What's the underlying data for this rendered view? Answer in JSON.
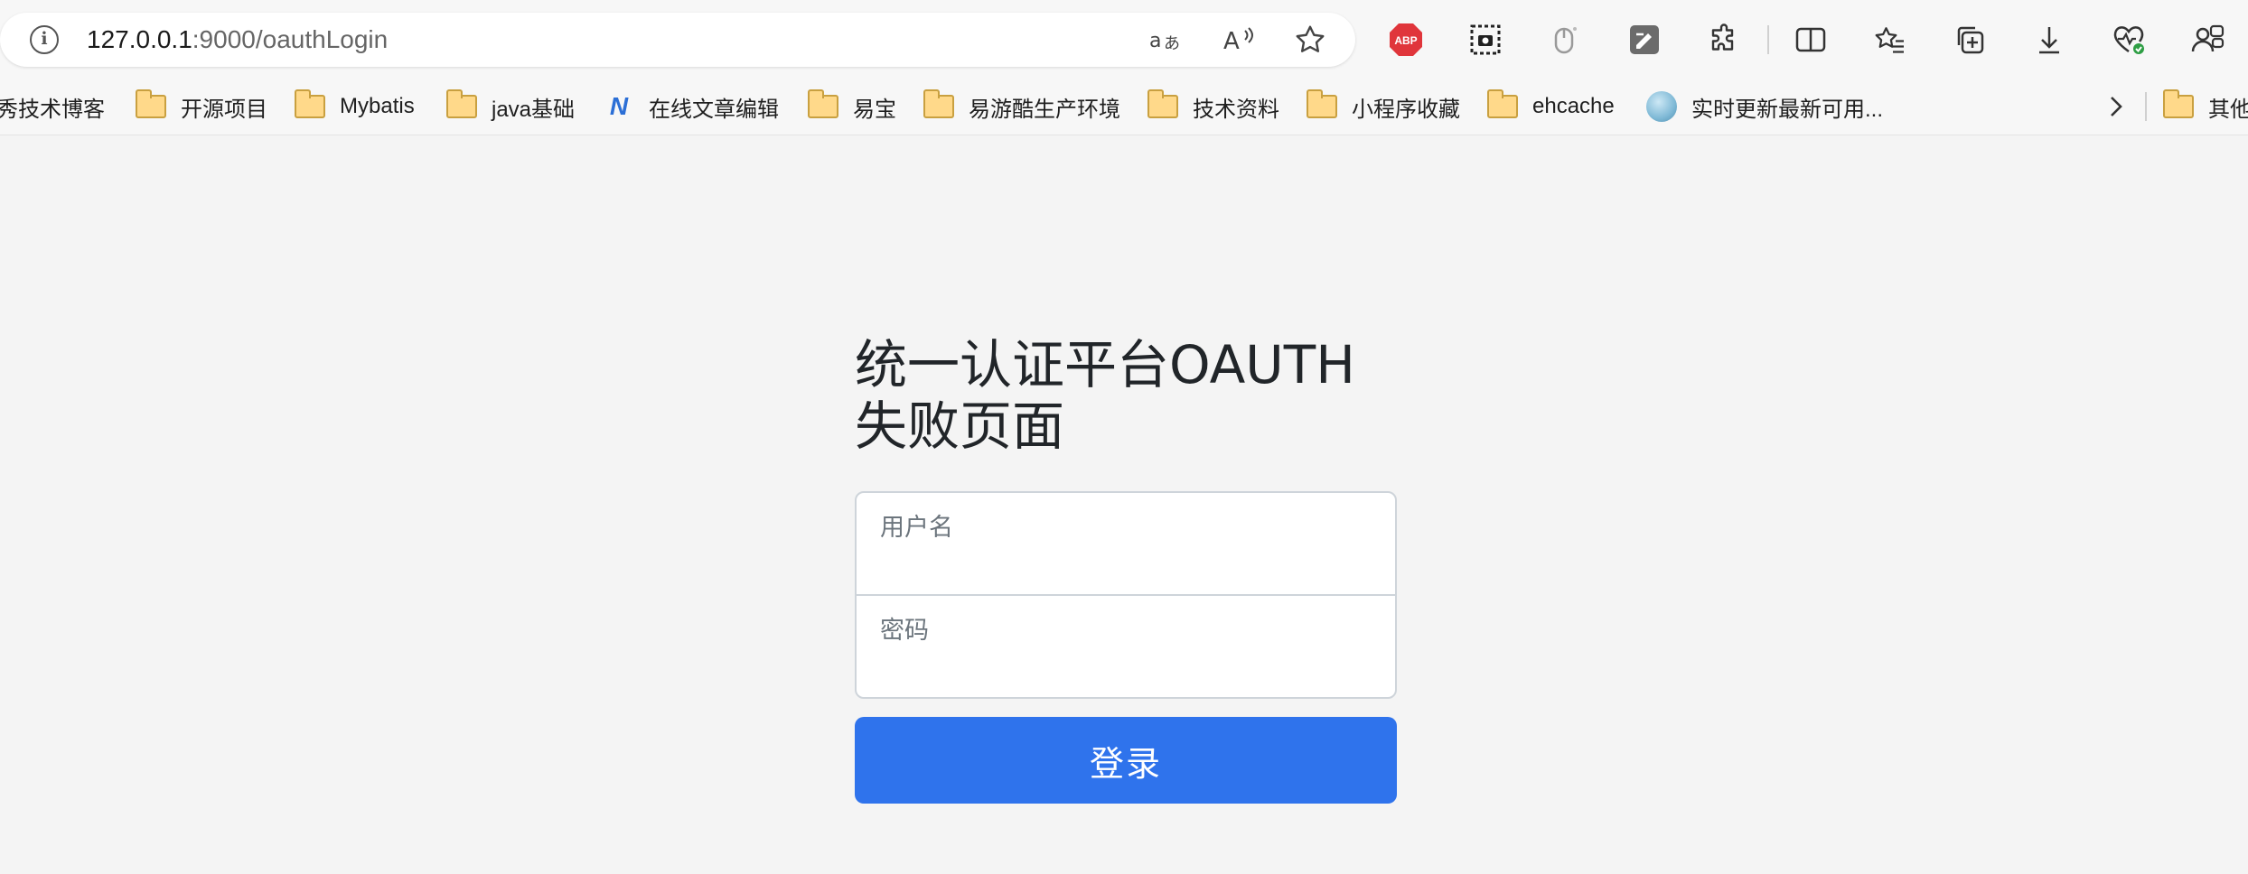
{
  "browser": {
    "url_host": "127.0.0.1",
    "url_path": ":9000/oauthLogin",
    "icons": {
      "info": "info-icon",
      "translate": "translate-icon",
      "read_aloud": "read-aloud-icon",
      "favorite": "star-icon",
      "adblock": "adblock-icon",
      "screenshot": "screenshot-icon",
      "mouse": "mouse-icon",
      "notes": "notes-icon",
      "extensions": "puzzle-icon",
      "split": "split-screen-icon",
      "favorites": "favorites-icon",
      "collections": "collections-icon",
      "download": "download-icon",
      "health": "browser-essentials-icon",
      "profile": "profile-icon"
    },
    "adblock_label": "ABP"
  },
  "bookmarks": [
    {
      "label": "秀技术博客",
      "icon": "none"
    },
    {
      "label": "开源项目",
      "icon": "folder"
    },
    {
      "label": "Mybatis",
      "icon": "folder"
    },
    {
      "label": "java基础",
      "icon": "folder"
    },
    {
      "label": "在线文章编辑",
      "icon": "site"
    },
    {
      "label": "易宝",
      "icon": "folder"
    },
    {
      "label": "易游酷生产环境",
      "icon": "folder"
    },
    {
      "label": "技术资料",
      "icon": "folder"
    },
    {
      "label": "小程序收藏",
      "icon": "folder"
    },
    {
      "label": "ehcache",
      "icon": "folder"
    },
    {
      "label": "实时更新最新可用...",
      "icon": "globe"
    },
    {
      "label": "其他",
      "icon": "folder"
    }
  ],
  "site_glyph": "N",
  "form": {
    "title": "统一认证平台OAUTH失败页面",
    "username_label": "用户名",
    "password_label": "密码",
    "username_value": "",
    "password_value": "",
    "submit_label": "登录"
  },
  "colors": {
    "primary": "#2f73ec",
    "page_bg": "#f4f4f4"
  }
}
